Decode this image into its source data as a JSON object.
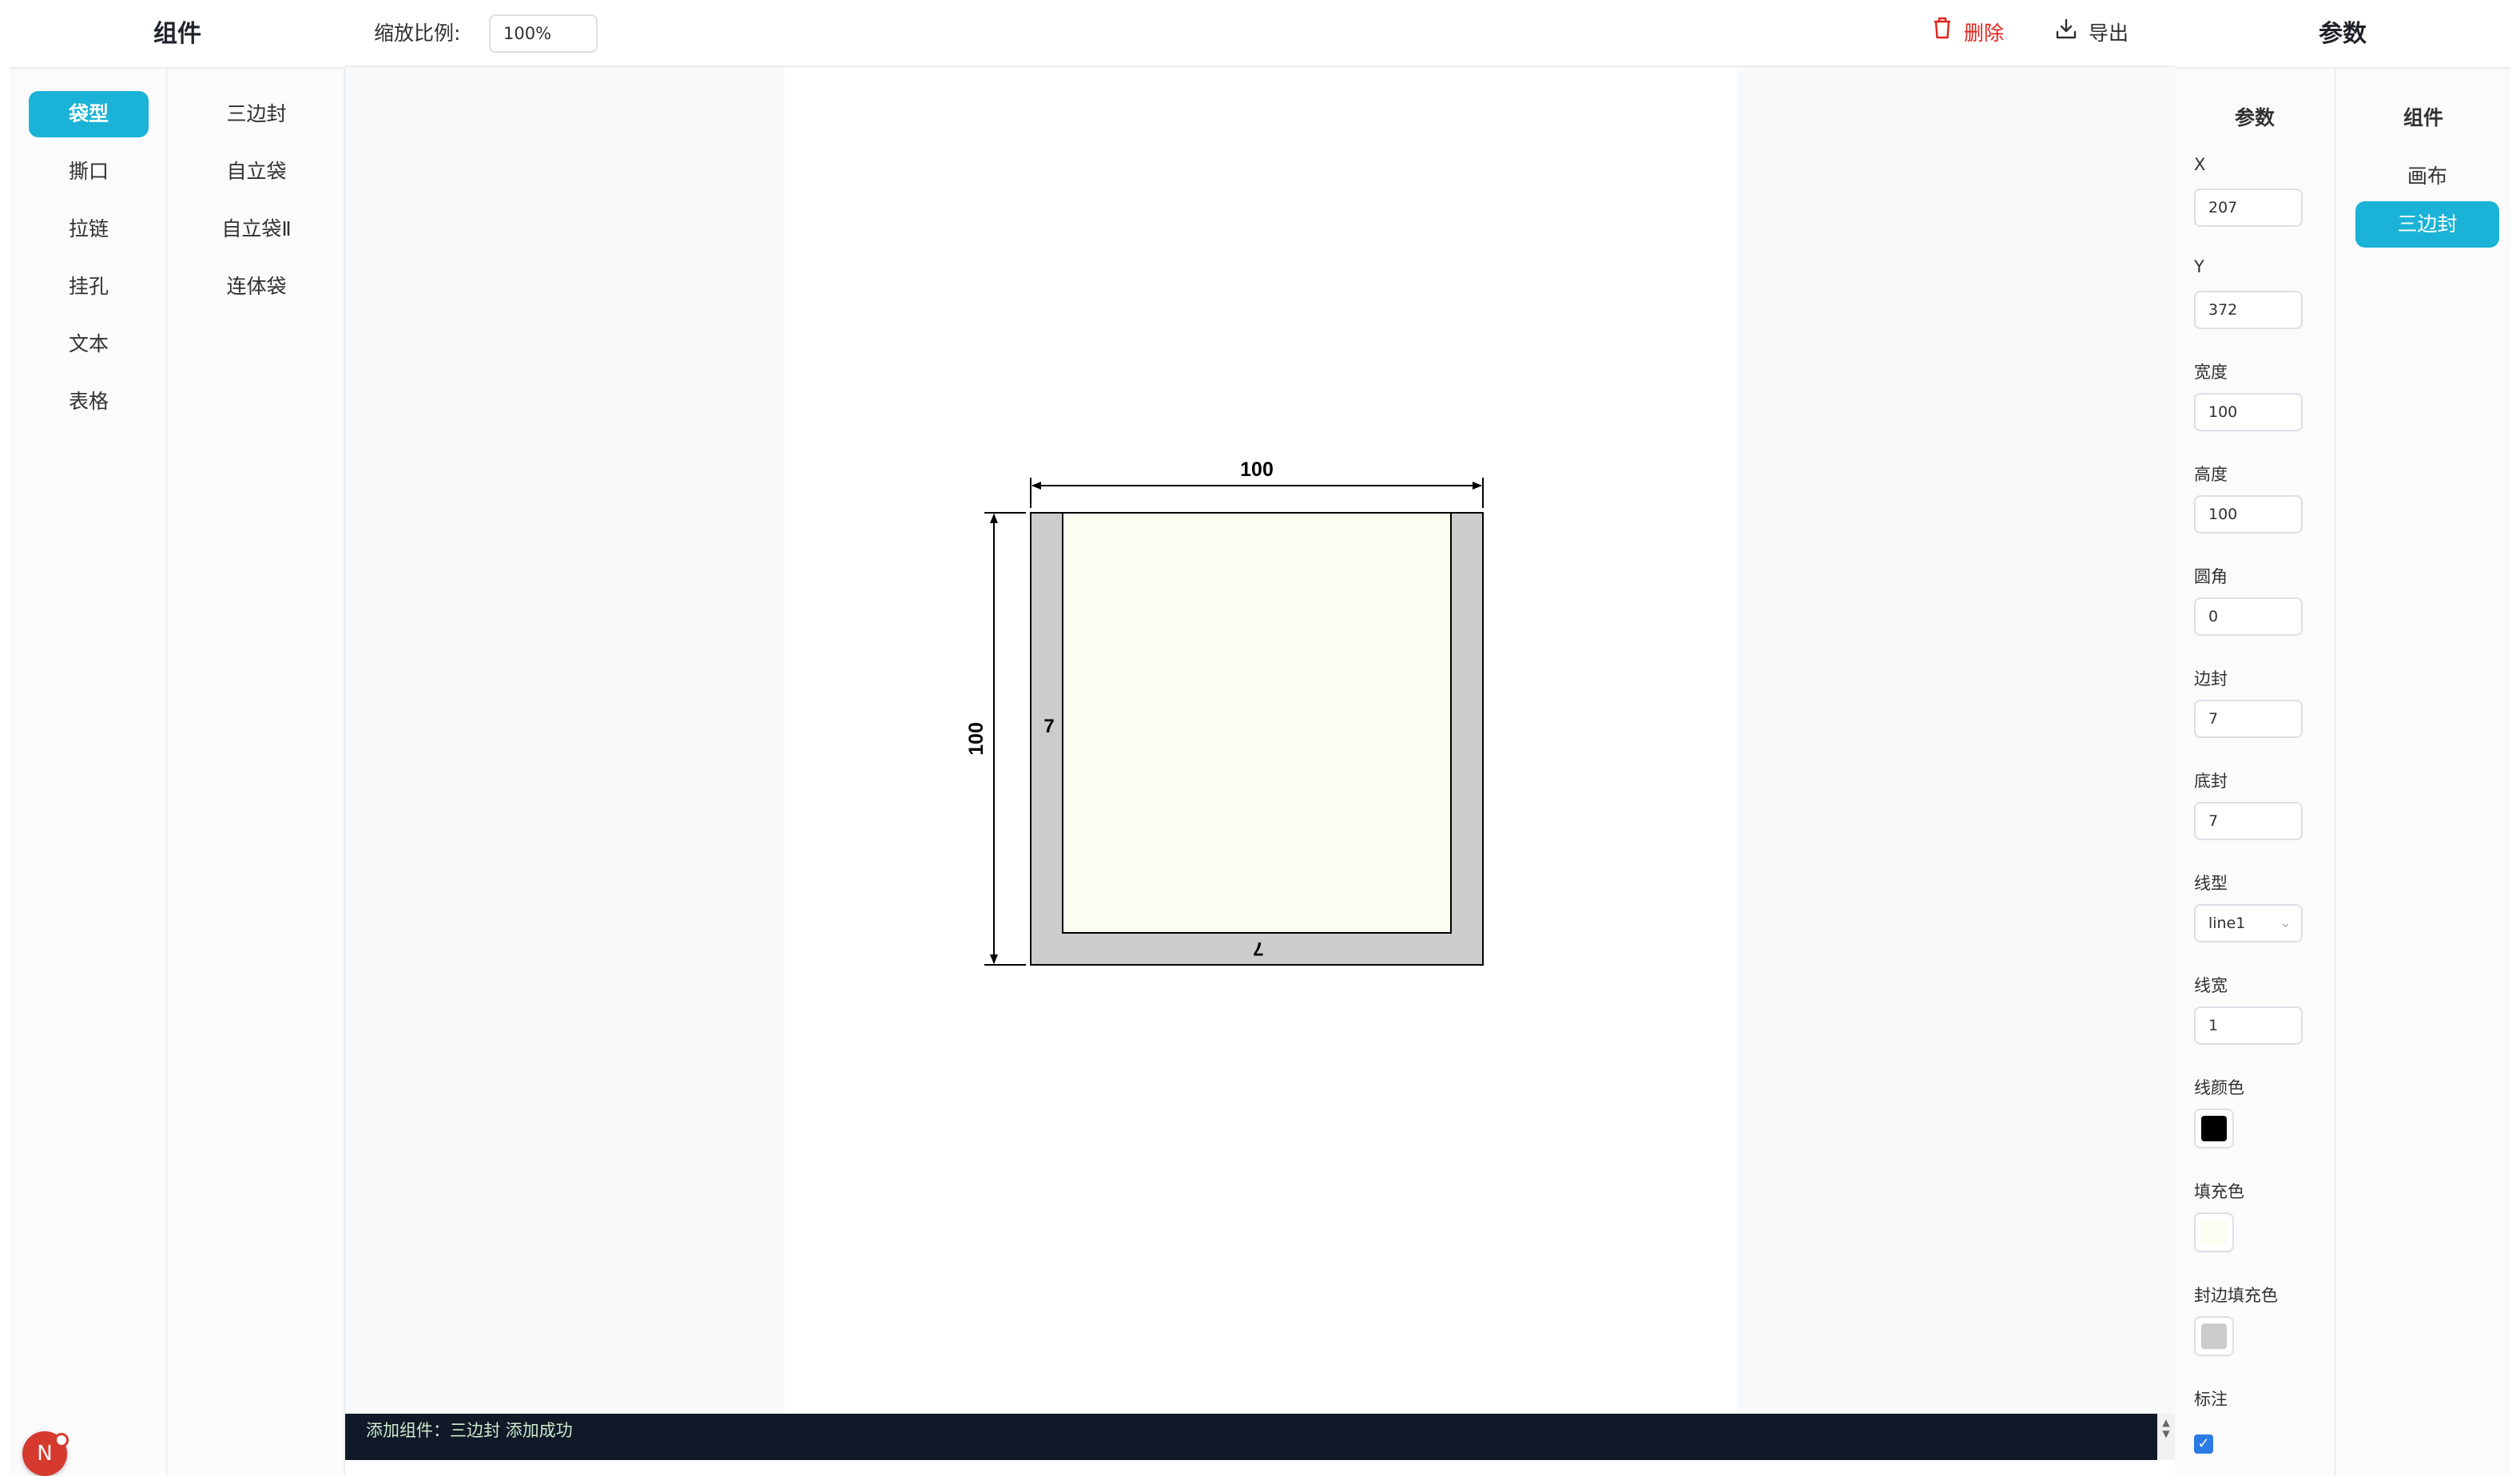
{
  "left_panel": {
    "title": "组件",
    "categories": [
      "袋型",
      "撕口",
      "拉链",
      "挂孔",
      "文本",
      "表格"
    ],
    "active_category": "袋型",
    "subitems": [
      "三边封",
      "自立袋",
      "自立袋Ⅱ",
      "连体袋"
    ],
    "avatar_letter": "N"
  },
  "toolbar": {
    "zoom_label": "缩放比例:",
    "zoom_value": "100%",
    "delete_label": "删除",
    "export_label": "导出",
    "delete_color": "#e2231a"
  },
  "drawing": {
    "width_dimension": "100",
    "height_dimension": "100",
    "side_seal_label": "7",
    "bottom_seal_label": "7",
    "fill_color": "#fafdf0",
    "seal_fill_color": "#cccccc",
    "line_color": "#000000"
  },
  "console": {
    "message": "添加组件：三边封 添加成功"
  },
  "right_panel": {
    "title": "参数",
    "params_header": "参数",
    "components_header": "组件",
    "fields": {
      "x": {
        "label": "X",
        "value": "207"
      },
      "y": {
        "label": "Y",
        "value": "372"
      },
      "width": {
        "label": "宽度",
        "value": "100"
      },
      "height": {
        "label": "高度",
        "value": "100"
      },
      "radius": {
        "label": "圆角",
        "value": "0"
      },
      "side_seal": {
        "label": "边封",
        "value": "7"
      },
      "bottom_seal": {
        "label": "底封",
        "value": "7"
      },
      "line_type": {
        "label": "线型",
        "value": "line1"
      },
      "line_width": {
        "label": "线宽",
        "value": "1"
      },
      "line_color": {
        "label": "线颜色",
        "value": "#000000"
      },
      "fill_color": {
        "label": "填充色",
        "value": "#fafdf0"
      },
      "seal_fill_color": {
        "label": "封边填充色",
        "value": "#cccccc"
      },
      "annotation": {
        "label": "标注",
        "checked": true
      }
    },
    "components": [
      "画布",
      "三边封"
    ],
    "active_component": "三边封",
    "accent": "#1ab3d7"
  }
}
